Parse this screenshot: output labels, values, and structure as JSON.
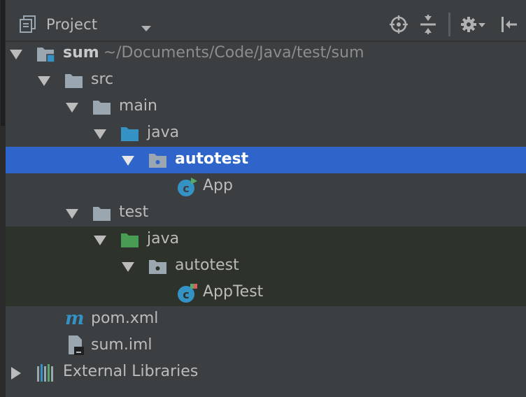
{
  "toolbar": {
    "title": "Project",
    "buttons": [
      "locate-icon",
      "collapse-all-icon",
      "gear-icon",
      "hide-panel-icon"
    ]
  },
  "tree": {
    "root": {
      "name": "sum",
      "path": "~/Documents/Code/Java/test/sum"
    },
    "src": "src",
    "main": "main",
    "main_java": "java",
    "main_package": "autotest",
    "main_class": "App",
    "test": "test",
    "test_java": "java",
    "test_package": "autotest",
    "test_class": "AppTest",
    "pom": "pom.xml",
    "iml": "sum.iml",
    "external": "External Libraries"
  },
  "colors": {
    "background": "#3c3f41",
    "selection": "#2f65ca",
    "test_region": "#2d332a",
    "source_folder": "#3592c4",
    "test_folder": "#499c54",
    "folder": "#9aa7b0"
  }
}
